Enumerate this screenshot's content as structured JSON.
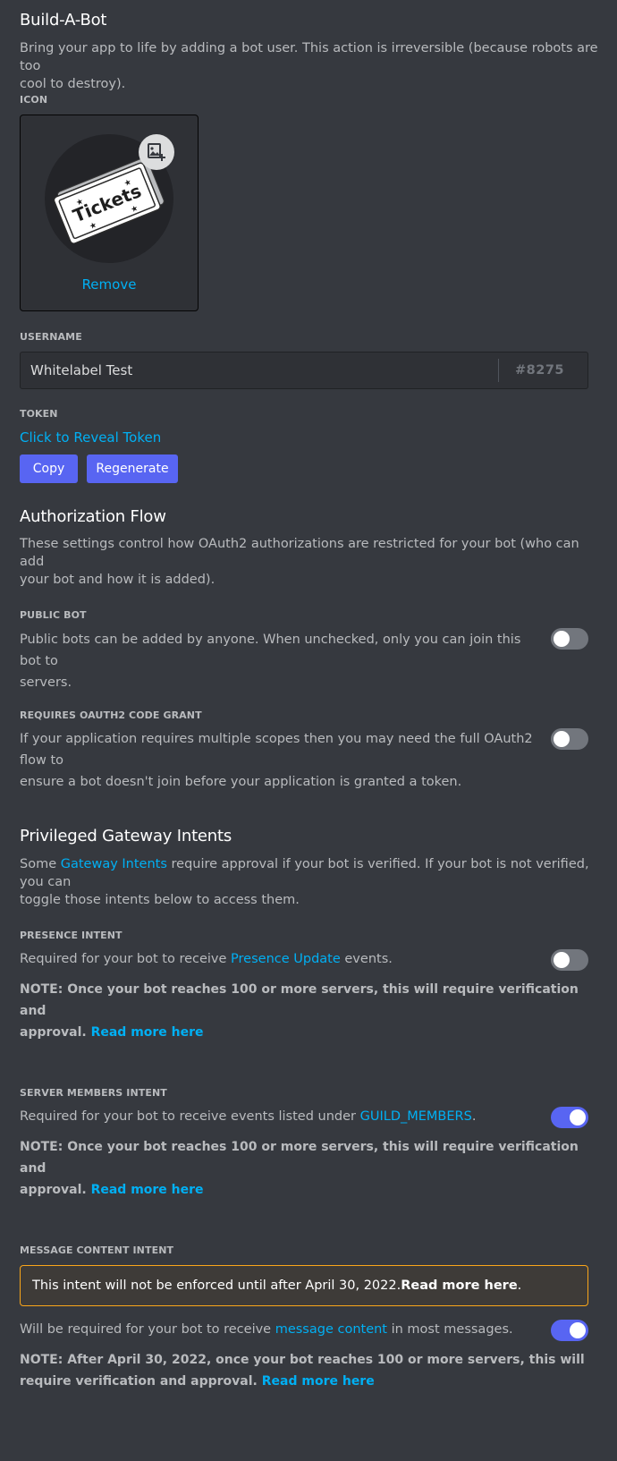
{
  "build_a_bot": {
    "title": "Build-A-Bot",
    "description_line1": "Bring your app to life by adding a bot user. This action is irreversible (because robots are too",
    "description_line2": "cool to destroy).",
    "icon_label": "ICON",
    "avatar_ticket_text": "Tickets",
    "remove_label": "Remove",
    "username_label": "USERNAME",
    "username_value": "Whitelabel Test",
    "discriminator": "#8275",
    "token_label": "TOKEN",
    "reveal_token_label": "Click to Reveal Token",
    "copy_label": "Copy",
    "regenerate_label": "Regenerate"
  },
  "authorization_flow": {
    "title": "Authorization Flow",
    "description_line1": "These settings control how OAuth2 authorizations are restricted for your bot (who can add",
    "description_line2": "your bot and how it is added).",
    "public_bot": {
      "label": "PUBLIC BOT",
      "description_line1": "Public bots can be added by anyone. When unchecked, only you can join this bot to",
      "description_line2": "servers.",
      "enabled": false
    },
    "code_grant": {
      "label": "REQUIRES OAUTH2 CODE GRANT",
      "description_line1": "If your application requires multiple scopes then you may need the full OAuth2 flow to",
      "description_line2": "ensure a bot doesn't join before your application is granted a token.",
      "enabled": false
    }
  },
  "privileged_intents": {
    "title": "Privileged Gateway Intents",
    "description_pre": "Some ",
    "description_link": "Gateway Intents",
    "description_post": " require approval if your bot is verified. If your bot is not verified, you can",
    "description_line2": "toggle those intents below to access them.",
    "presence": {
      "label": "PRESENCE INTENT",
      "text_pre": "Required for your bot to receive ",
      "text_link": "Presence Update",
      "text_post": " events.",
      "note_line1": "NOTE: Once your bot reaches 100 or more servers, this will require verification and",
      "note_line2": "approval. ",
      "note_link": "Read more here",
      "enabled": false
    },
    "server_members": {
      "label": "SERVER MEMBERS INTENT",
      "text_pre": "Required for your bot to receive events listed under ",
      "text_link": "GUILD_MEMBERS",
      "text_post": ".",
      "note_line1": "NOTE: Once your bot reaches 100 or more servers, this will require verification and",
      "note_line2": "approval. ",
      "note_link": "Read more here",
      "enabled": true
    },
    "message_content": {
      "label": "MESSAGE CONTENT INTENT",
      "warning_pre": "This intent will not be enforced until after April 30, 2022. ",
      "warning_bold": "Read more here",
      "warning_post": ".",
      "text_pre": "Will be required for your bot to receive ",
      "text_link": "message content",
      "text_post": " in most messages.",
      "note_line1": "NOTE: After April 30, 2022, once your bot reaches 100 or more servers, this will",
      "note_line2": "require verification and approval. ",
      "note_link": "Read more here",
      "enabled": true
    }
  },
  "colors": {
    "background": "#36393f",
    "link": "#00b0f4",
    "brand": "#5865f2",
    "warning_border": "#faa61a"
  }
}
